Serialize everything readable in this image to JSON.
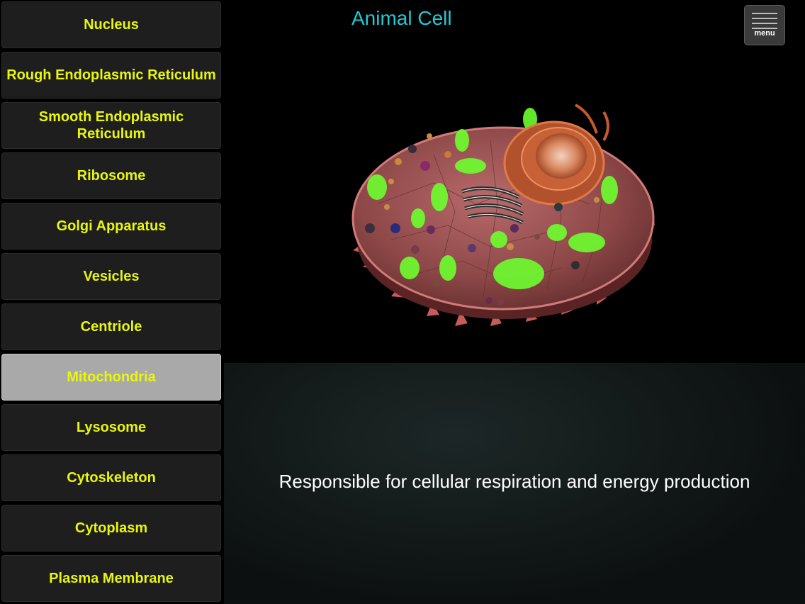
{
  "title": "Animal Cell",
  "menu": {
    "label": "menu",
    "icon": "hamburger-icon"
  },
  "organelles": [
    {
      "label": "Nucleus",
      "selected": false
    },
    {
      "label": "Rough Endoplasmic Reticulum",
      "selected": false
    },
    {
      "label": "Smooth Endoplasmic Reticulum",
      "selected": false
    },
    {
      "label": "Ribosome",
      "selected": false
    },
    {
      "label": "Golgi Apparatus",
      "selected": false
    },
    {
      "label": "Vesicles",
      "selected": false
    },
    {
      "label": "Centriole",
      "selected": false
    },
    {
      "label": "Mitochondria",
      "selected": true
    },
    {
      "label": "Lysosome",
      "selected": false
    },
    {
      "label": "Cytoskeleton",
      "selected": false
    },
    {
      "label": "Cytoplasm",
      "selected": false
    },
    {
      "label": "Plasma Membrane",
      "selected": false
    }
  ],
  "description": "Responsible for cellular respiration and energy production",
  "colors": {
    "title": "#22c9d6",
    "button_text": "#e8f70a",
    "button_bg": "#1e1e1e",
    "button_selected_bg": "#a9a9a9"
  }
}
